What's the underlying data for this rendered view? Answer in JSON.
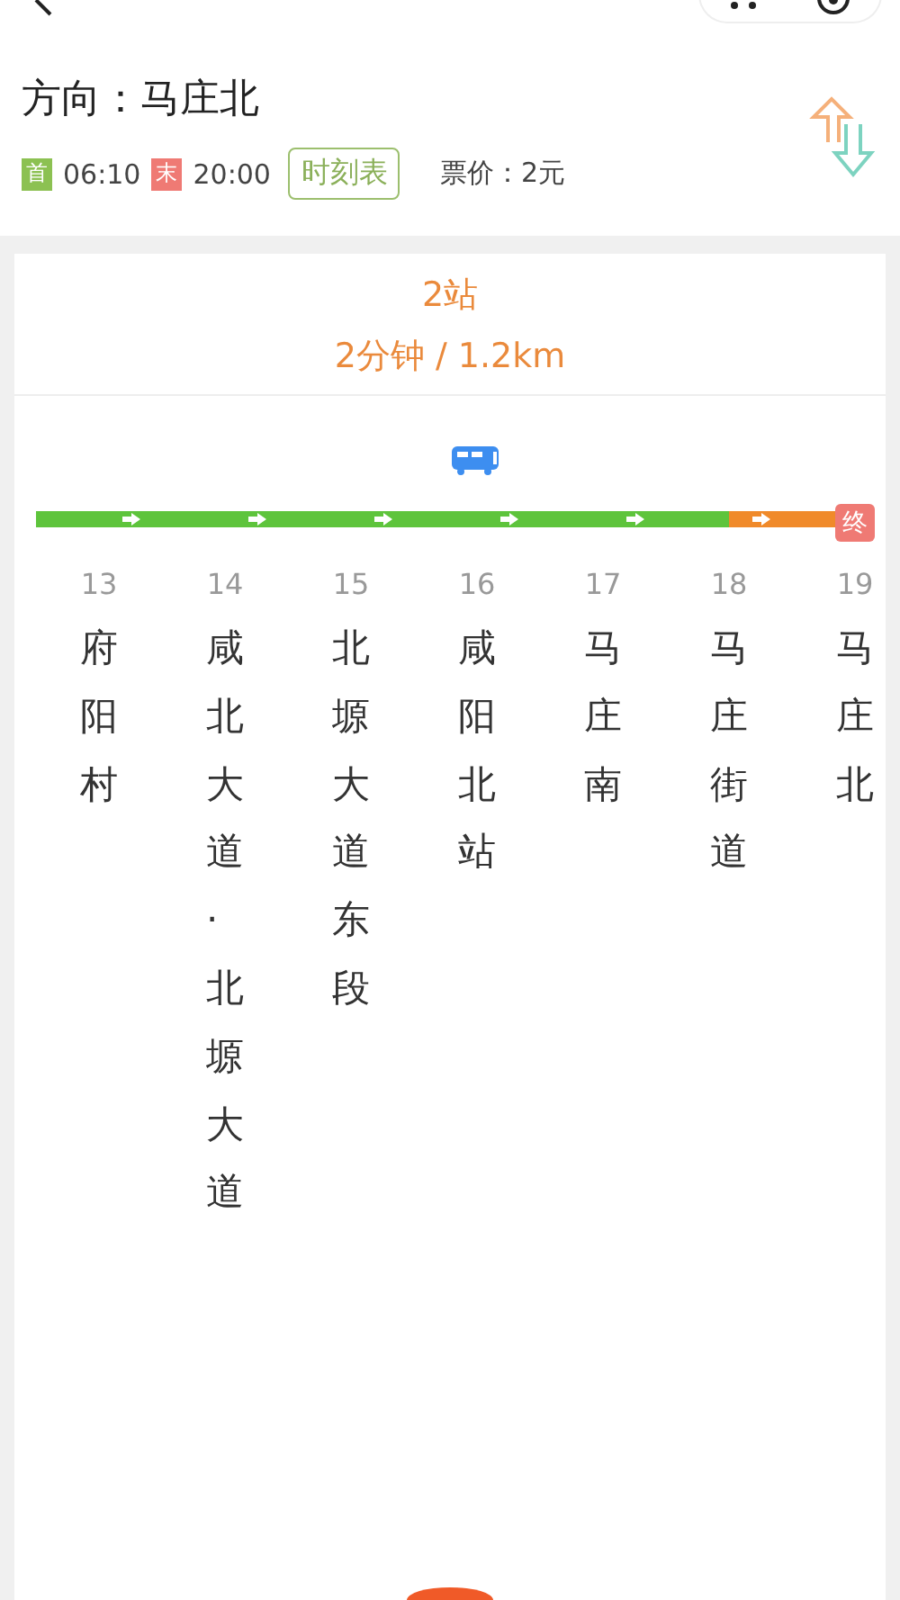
{
  "direction": {
    "label": "方向：",
    "value": "马庄北"
  },
  "schedule": {
    "first_badge": "首",
    "first_time": "06:10",
    "last_badge": "末",
    "last_time": "20:00",
    "timetable_button": "时刻表",
    "fare": "票价：2元"
  },
  "summary": {
    "stops": "2站",
    "detail": "2分钟 / 1.2km"
  },
  "segments": [
    {
      "color": "#5ec43c"
    },
    {
      "color": "#5ec43c"
    },
    {
      "color": "#5ec43c"
    },
    {
      "color": "#5ec43c"
    },
    {
      "color": "#5ec43c"
    },
    {
      "color": "#f08a2a"
    }
  ],
  "stops": [
    {
      "number": "13",
      "name": "府阳村",
      "bus": false,
      "terminal": false
    },
    {
      "number": "14",
      "name": "咸北大道·北塬大道",
      "bus": false,
      "terminal": false
    },
    {
      "number": "15",
      "name": "北塬大道东段",
      "bus": false,
      "terminal": false
    },
    {
      "number": "16",
      "name": "咸阳北站",
      "bus": true,
      "terminal": false
    },
    {
      "number": "17",
      "name": "马庄南",
      "bus": false,
      "terminal": false
    },
    {
      "number": "18",
      "name": "马庄街道",
      "bus": false,
      "terminal": false
    },
    {
      "number": "19",
      "name": "马庄北",
      "bus": false,
      "terminal": true,
      "badge": "终"
    }
  ]
}
